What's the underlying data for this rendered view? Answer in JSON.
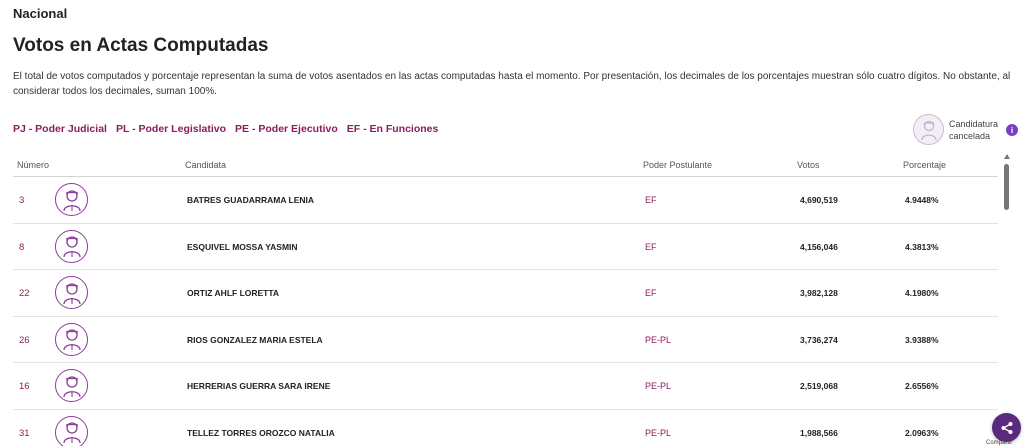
{
  "header": {
    "scope": "Nacional",
    "title": "Votos en Actas Computadas",
    "description": "El total de votos computados y porcentaje representan la suma de votos asentados en las actas computadas hasta el momento. Por presentación, los decimales de los porcentajes muestran sólo cuatro dígitos. No obstante, al considerar todos los decimales, suman 100%."
  },
  "legend": [
    "PJ - Poder Judicial",
    "PL - Poder Legislativo",
    "PE - Poder Ejecutivo",
    "EF - En Funciones"
  ],
  "cancel_indicator": {
    "label": "Candidatura cancelada",
    "icon": "user-avatar-icon",
    "info_icon": "info-icon",
    "info_glyph": "i",
    "info_color": "#7b3fc4"
  },
  "table": {
    "columns": {
      "numero": "Número",
      "candidata": "Candidata",
      "poder": "Poder Postulante",
      "votos": "Votos",
      "porcentaje": "Porcentaje"
    },
    "rows": [
      {
        "numero": "3",
        "candidata": "BATRES GUADARRAMA LENIA",
        "poder": "EF",
        "votos": "4,690,519",
        "porcentaje": "4.9448%"
      },
      {
        "numero": "8",
        "candidata": "ESQUIVEL MOSSA YASMIN",
        "poder": "EF",
        "votos": "4,156,046",
        "porcentaje": "4.3813%"
      },
      {
        "numero": "22",
        "candidata": "ORTIZ AHLF LORETTA",
        "poder": "EF",
        "votos": "3,982,128",
        "porcentaje": "4.1980%"
      },
      {
        "numero": "26",
        "candidata": "RIOS GONZALEZ MARIA ESTELA",
        "poder": "PE-PL",
        "votos": "3,736,274",
        "porcentaje": "3.9388%"
      },
      {
        "numero": "16",
        "candidata": "HERRERIAS GUERRA SARA IRENE",
        "poder": "PE-PL",
        "votos": "2,519,068",
        "porcentaje": "2.6556%"
      },
      {
        "numero": "31",
        "candidata": "TELLEZ TORRES OROZCO NATALIA",
        "poder": "PE-PL",
        "votos": "1,988,566",
        "porcentaje": "2.0963%"
      }
    ]
  },
  "share": {
    "label": "Compartir",
    "icon": "share-icon"
  },
  "colors": {
    "accent": "#8a1e5c",
    "avatar_border": "#8a3d9a",
    "share_bg": "#5a2a7e"
  }
}
